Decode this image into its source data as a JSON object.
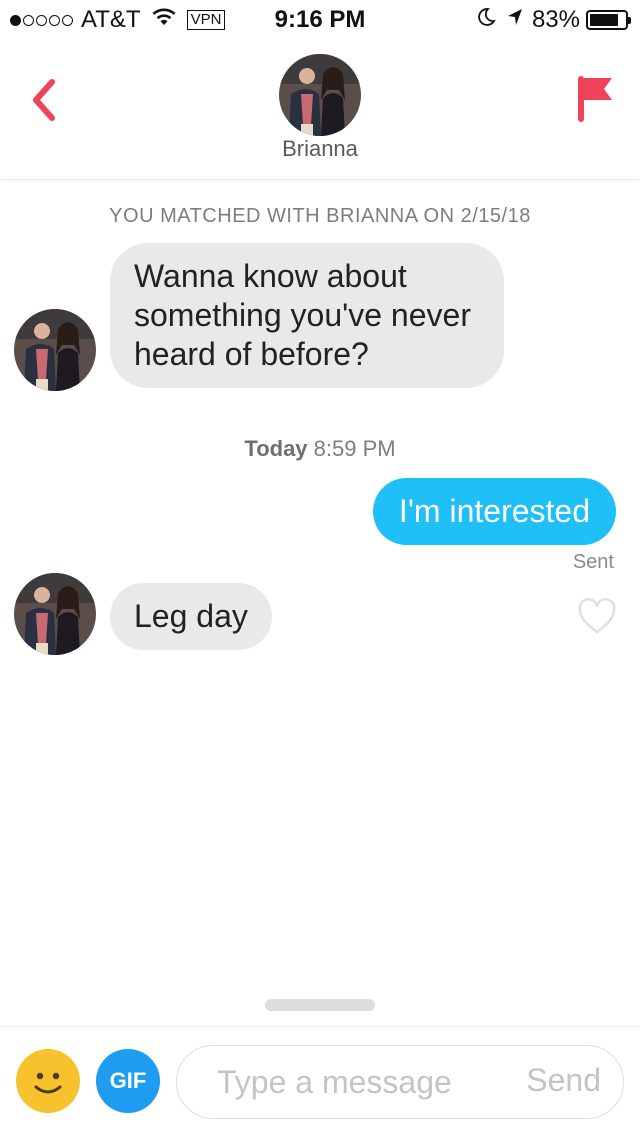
{
  "status_bar": {
    "carrier": "AT&T",
    "vpn": "VPN",
    "time": "9:16 PM",
    "battery": "83%",
    "battery_level": 0.83,
    "signal_bars": 1,
    "signal_total": 5
  },
  "header": {
    "name": "Brianna",
    "back_icon": "chevron-left-icon",
    "flag_icon": "flag-icon",
    "accent_color": "#f0435a"
  },
  "chat": {
    "match_notice": "YOU MATCHED WITH BRIANNA ON 2/15/18",
    "messages": [
      {
        "from": "them",
        "text": "Wanna know about something you've never heard of before?"
      },
      {
        "from": "me",
        "text": "I'm interested",
        "status": "Sent"
      },
      {
        "from": "them",
        "text": "Leg day"
      }
    ],
    "timestamp_day": "Today",
    "timestamp_time": "8:59 PM",
    "outgoing_color": "#1ec0f7",
    "incoming_color": "#e9e9e9"
  },
  "composer": {
    "gif_label": "GIF",
    "placeholder": "Type a message",
    "send_label": "Send"
  }
}
